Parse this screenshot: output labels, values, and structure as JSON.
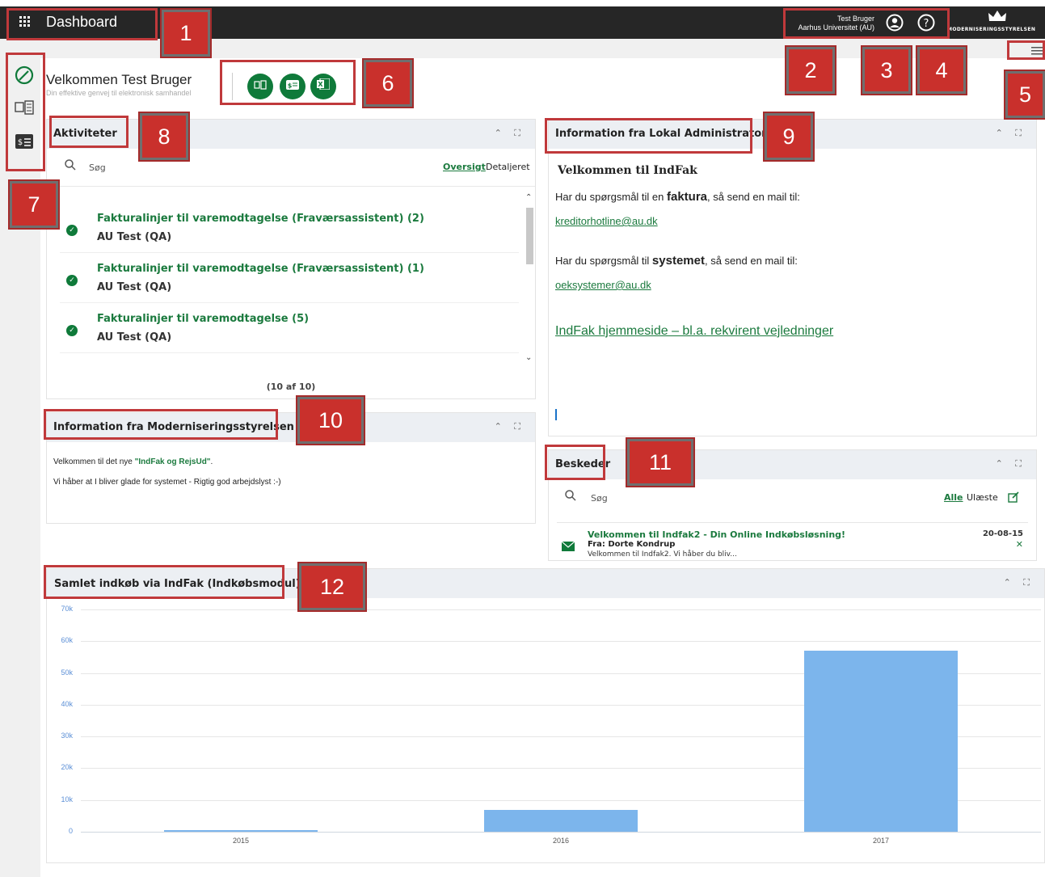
{
  "header": {
    "app_title": "Dashboard",
    "user_name": "Test Bruger",
    "user_org": "Aarhus Universitet (AU)",
    "brand_text": "MODERNISERINGSSTYRELSEN"
  },
  "welcome": {
    "title": "Velkommen Test Bruger",
    "subtitle": "Din effektive genvej til elektronisk samhandel"
  },
  "quick_actions": [
    {
      "icon": "invoice-list-icon"
    },
    {
      "icon": "dollar-doc-icon"
    },
    {
      "icon": "excel-icon"
    }
  ],
  "left_nav": [
    {
      "icon": "dashboard-icon"
    },
    {
      "icon": "invoice-list-icon"
    },
    {
      "icon": "dollar-doc-icon"
    }
  ],
  "annotations": [
    "1",
    "2",
    "3",
    "4",
    "5",
    "6",
    "7",
    "8",
    "9",
    "10",
    "11",
    "12"
  ],
  "activities": {
    "title": "Aktiviteter",
    "search_placeholder": "Søg",
    "tab_overview": "Oversigt",
    "tab_detailed": "Detaljeret",
    "items": [
      {
        "title": "Fakturalinjer til varemodtagelse (Fraværsassistent) (2)",
        "sub": "AU Test (QA)"
      },
      {
        "title": "Fakturalinjer til varemodtagelse (Fraværsassistent) (1)",
        "sub": "AU Test (QA)"
      },
      {
        "title": "Fakturalinjer til varemodtagelse (5)",
        "sub": "AU Test (QA)"
      }
    ],
    "count": "(10 af 10)"
  },
  "admin_info": {
    "title": "Information fra Lokal Administrator",
    "heading": "Velkommen til IndFak",
    "line1_pre": "Har du spørgsmål til en ",
    "line1_bold": "faktura",
    "line1_post": ", så send en mail til:",
    "email1": "kreditorhotline@au.dk",
    "line2_pre": "Har du spørgsmål til ",
    "line2_bold": "systemet",
    "line2_post": ", så send en mail til:",
    "email2": "oeksystemer@au.dk",
    "homepage": "IndFak hjemmeside – bl.a. rekvirent vejledninger"
  },
  "modst_info": {
    "title": "Information fra Moderniseringsstyrelsen",
    "line1_pre": "Velkommen til det nye ",
    "line1_link": "\"IndFak og RejsUd\"",
    "line1_post": ".",
    "line2": "Vi håber at I bliver glade for systemet - Rigtig god arbejdslyst :-)"
  },
  "messages": {
    "title": "Beskeder",
    "search_placeholder": "Søg",
    "filter_all": "Alle",
    "filter_unread": "Ulæste",
    "items": [
      {
        "subject": "Velkommen til Indfak2 - Din Online Indkøbsløsning!",
        "from": "Fra: Dorte Kondrup",
        "preview": "Velkommen til Indfak2. Vi håber du bliv...",
        "date": "20-08-15"
      }
    ]
  },
  "chart_data": {
    "type": "bar",
    "title": "Samlet indkøb via IndFak (Indkøbsmodul)",
    "categories": [
      "2015",
      "2016",
      "2017"
    ],
    "values": [
      500,
      7000,
      57000
    ],
    "ylim": [
      0,
      70000
    ],
    "yticks": [
      "0",
      "10k",
      "20k",
      "30k",
      "40k",
      "50k",
      "60k",
      "70k"
    ],
    "color": "#7cb5ec",
    "grid": true
  }
}
